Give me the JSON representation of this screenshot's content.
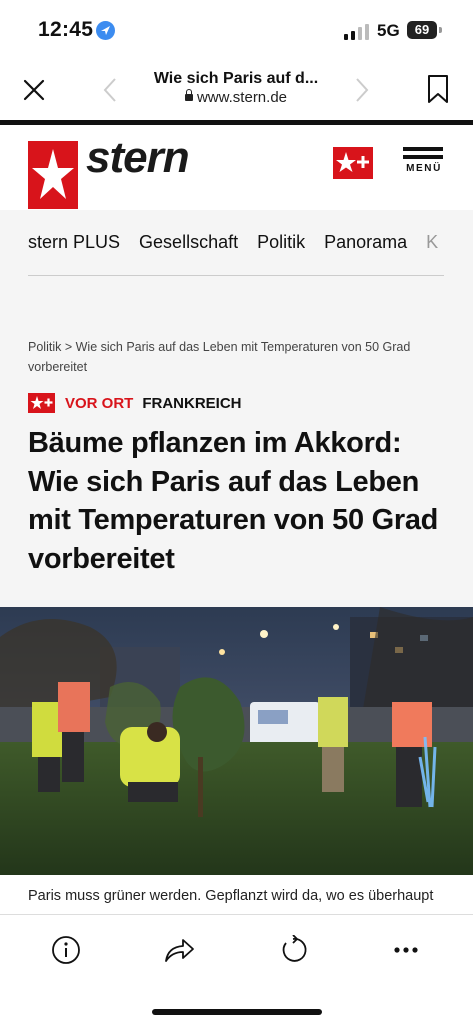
{
  "status_bar": {
    "time": "12:45",
    "network": "5G",
    "battery": "69"
  },
  "browser": {
    "page_title": "Wie sich Paris auf d...",
    "url": "www.stern.de",
    "close_icon": "close-icon",
    "back_icon": "chevron-left-icon",
    "forward_icon": "chevron-right-icon",
    "bookmark_icon": "bookmark-icon"
  },
  "site": {
    "logo_text": "stern",
    "menu_label": "MENÜ",
    "brand_red": "#d8141b"
  },
  "nav": {
    "items": [
      "stern PLUS",
      "Gesellschaft",
      "Politik",
      "Panorama",
      "K"
    ]
  },
  "article": {
    "breadcrumb_section": "Politik",
    "breadcrumb_separator": ">",
    "breadcrumb_title": "Wie sich Paris auf das Leben mit Temperaturen von 50 Grad vorbereitet",
    "kicker": "VOR ORT",
    "region": "FRANKREICH",
    "headline": "Bäume pflanzen im Akkord: Wie sich Paris auf das Leben mit Temperaturen von 50 Grad vorbereitet",
    "teaser": "Paris muss grüner werden. Gepflanzt wird da, wo es überhaupt"
  },
  "toolbar": {
    "icons": [
      "info-icon",
      "share-icon",
      "reload-icon",
      "more-icon"
    ]
  }
}
